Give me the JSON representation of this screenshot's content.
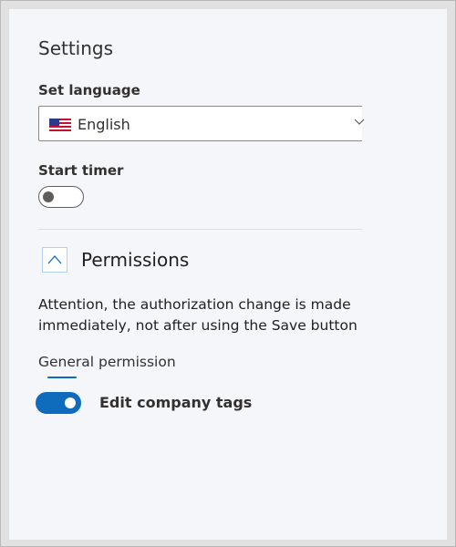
{
  "settings": {
    "title": "Settings",
    "language": {
      "label": "Set language",
      "selected": "English",
      "flag_icon": "us-flag-icon"
    },
    "timer": {
      "label": "Start timer",
      "enabled": false
    },
    "permissions": {
      "title": "Permissions",
      "expanded": true,
      "notice_line1": "Attention, the authorization change is made",
      "notice_line2": "immediately, not after using the Save button",
      "group_label": "General permission",
      "toggle_label": "Edit company tags",
      "toggle_enabled": true
    }
  },
  "colors": {
    "accent": "#0f6cbd",
    "panel_bg": "#f5f6fa",
    "outer_bg": "#e1e1e1"
  }
}
